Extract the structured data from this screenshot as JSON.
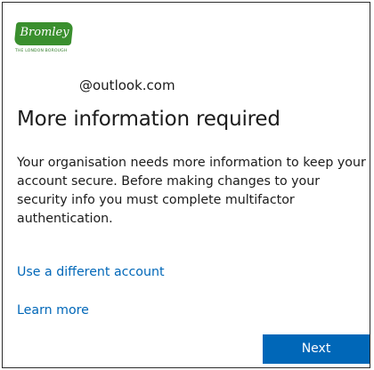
{
  "logo": {
    "wordmark": "Bromley",
    "tagline": "THE LONDON BOROUGH"
  },
  "identity": {
    "email": "@outlook.com"
  },
  "title": "More information required",
  "description": "Your organisation needs more information to keep your account secure. Before making changes to your security info you must complete multifactor authentication.",
  "links": {
    "different_account": "Use a different account",
    "learn_more": "Learn more"
  },
  "buttons": {
    "next": "Next"
  },
  "colors": {
    "accent": "#0067b8",
    "logo_green": "#3a8f2e"
  }
}
